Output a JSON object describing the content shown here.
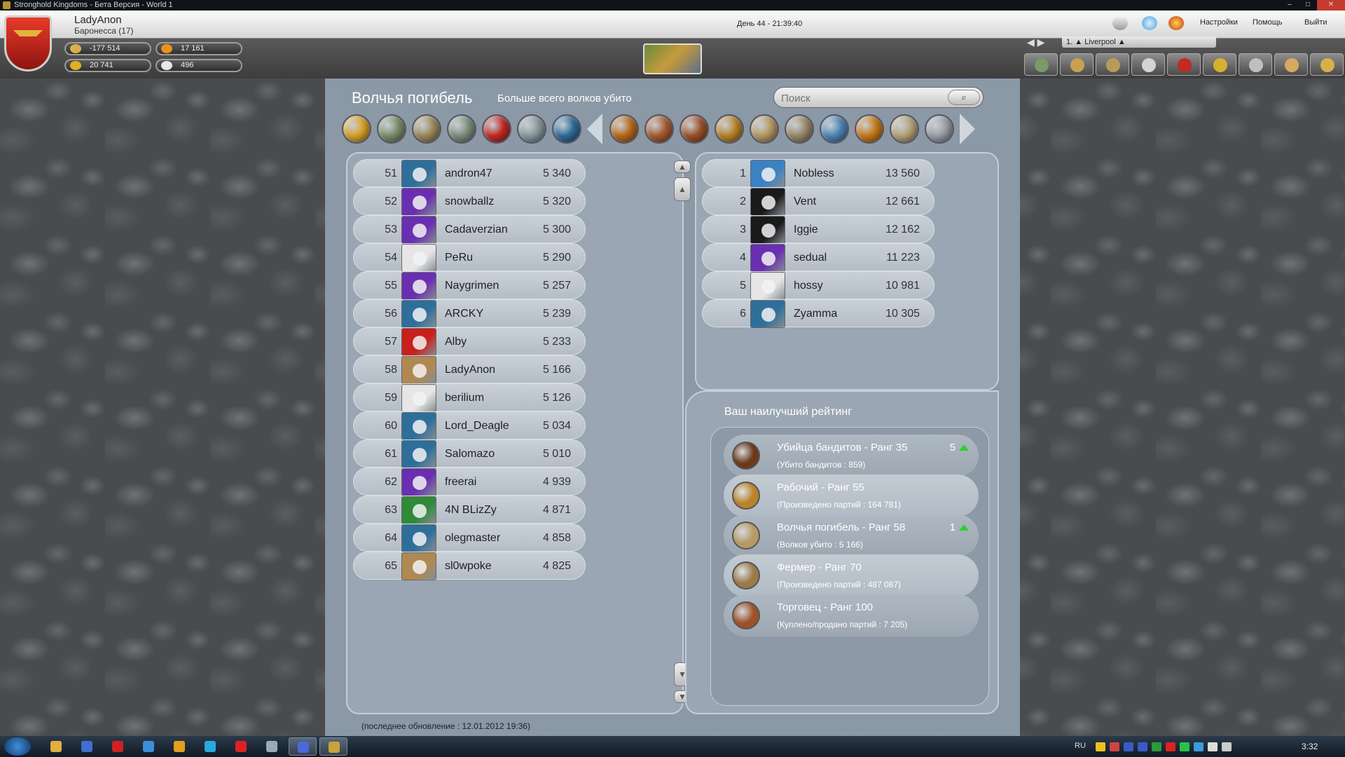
{
  "window": {
    "title": "Stronghold Kingdoms - Бета Версия - World 1",
    "controls": [
      "–",
      "□",
      "✕"
    ]
  },
  "header": {
    "player_name": "LadyAnon",
    "player_rank": "Баронесса (17)",
    "resources": [
      {
        "icon": "crown-icon",
        "value": "-177 514"
      },
      {
        "icon": "food-icon",
        "value": "17 161"
      },
      {
        "icon": "gold-coin-icon",
        "value": "20 741"
      },
      {
        "icon": "honor-icon",
        "value": "496"
      }
    ],
    "day_time": "День 44 - 21:39:40",
    "nav": {
      "settings": "Настройки",
      "help": "Помощь",
      "exit": "Выйти"
    },
    "village_arrows": "◀ ▶",
    "village": "1. ▲ Liverpool ▲"
  },
  "panel": {
    "title": "Волчья погибель",
    "subtitle": "Больше всего волков убито",
    "search": {
      "placeholder": "Поиск",
      "button": "⌕"
    },
    "categories": [
      {
        "name": "cat-orange",
        "color": "#d9a22a"
      },
      {
        "name": "cat-green",
        "color": "#7b8f6a"
      },
      {
        "name": "cat-camp",
        "color": "#9c8a5a"
      },
      {
        "name": "cat-tower",
        "color": "#7f8f7f"
      },
      {
        "name": "cat-red",
        "color": "#c12a24"
      },
      {
        "name": "cat-ship",
        "color": "#8a9a9e"
      },
      {
        "name": "cat-flag",
        "color": "#2f6c98"
      },
      {
        "name": "cat-castle",
        "color": "#b76a1c"
      },
      {
        "name": "cat-shield",
        "color": "#a85a2e"
      },
      {
        "name": "cat-bandit",
        "color": "#9c5228"
      },
      {
        "name": "cat-sword",
        "color": "#b8832a"
      },
      {
        "name": "cat-wolf",
        "color": "#b69a64"
      },
      {
        "name": "cat-farm",
        "color": "#9a8a6a"
      },
      {
        "name": "cat-globe",
        "color": "#4f86b4"
      },
      {
        "name": "cat-horse",
        "color": "#c77a18"
      },
      {
        "name": "cat-scroll",
        "color": "#b4a47a"
      },
      {
        "name": "cat-ruins",
        "color": "#9aa0a6"
      }
    ],
    "ranking": [
      {
        "rank": "51",
        "name": "andron47",
        "score": "5 340",
        "color": "#2e6f9a"
      },
      {
        "rank": "52",
        "name": "snowballz",
        "score": "5 320",
        "color": "#6a2fb0"
      },
      {
        "rank": "53",
        "name": "Cadaverzian",
        "score": "5 300",
        "color": "#6a2fb0"
      },
      {
        "rank": "54",
        "name": "PeRu",
        "score": "5 290",
        "color": "#e6e6e6"
      },
      {
        "rank": "55",
        "name": "Naygrimen",
        "score": "5 257",
        "color": "#6a2fb0"
      },
      {
        "rank": "56",
        "name": "ARCKY",
        "score": "5 239",
        "color": "#2e6f9a"
      },
      {
        "rank": "57",
        "name": "Alby",
        "score": "5 233",
        "color": "#c8201c"
      },
      {
        "rank": "58",
        "name": "LadyAnon",
        "score": "5 166",
        "color": "#b08852"
      },
      {
        "rank": "59",
        "name": "berilium",
        "score": "5 126",
        "color": "#e6e6e6"
      },
      {
        "rank": "60",
        "name": "Lord_Deagle",
        "score": "5 034",
        "color": "#2e6f9a"
      },
      {
        "rank": "61",
        "name": "Salomazo",
        "score": "5 010",
        "color": "#2e6f9a"
      },
      {
        "rank": "62",
        "name": "freerai",
        "score": "4 939",
        "color": "#6a2fb0"
      },
      {
        "rank": "63",
        "name": "4N BLizZy",
        "score": "4 871",
        "color": "#2f8a3a"
      },
      {
        "rank": "64",
        "name": "olegmaster",
        "score": "4 858",
        "color": "#2e6f9a"
      },
      {
        "rank": "65",
        "name": "sl0wpoke",
        "score": "4 825",
        "color": "#b08852"
      }
    ],
    "top": [
      {
        "rank": "1",
        "name": "Nobless",
        "score": "13 560",
        "color": "#3a82c4"
      },
      {
        "rank": "2",
        "name": "Vent",
        "score": "12 661",
        "color": "#1a1a1a"
      },
      {
        "rank": "3",
        "name": "Iggie",
        "score": "12 162",
        "color": "#1a1a1a"
      },
      {
        "rank": "4",
        "name": "sedual",
        "score": "11 223",
        "color": "#6a2fb0"
      },
      {
        "rank": "5",
        "name": "hossy",
        "score": "10 981",
        "color": "#e6e6e6"
      },
      {
        "rank": "6",
        "name": "Zyamma",
        "score": "10 305",
        "color": "#2e6f9a"
      }
    ],
    "best": {
      "title": "Ваш наилучший рейтинг",
      "items": [
        {
          "title": "Убийца бандитов - Ранг 35",
          "sub": "(Убито бандитов : 859)",
          "change": "5",
          "color": "#6a3a1a"
        },
        {
          "title": "Рабочий - Ранг 55",
          "sub": "(Произведено партий : 164 781)",
          "change": "",
          "color": "#b8832a"
        },
        {
          "title": "Волчья погибель - Ранг 58",
          "sub": "(Волков убито : 5 166)",
          "change": "1",
          "color": "#b69a64"
        },
        {
          "title": "Фермер - Ранг 70",
          "sub": "(Произведено партий : 487 087)",
          "change": "",
          "color": "#9a7a4a"
        },
        {
          "title": "Торговец - Ранг 100",
          "sub": "(Куплено/продано партий : 7 205)",
          "change": "",
          "color": "#9c5228"
        }
      ]
    },
    "updated": "(последнее обновление : 12.01.2012 19:36)"
  },
  "taskbar": {
    "apps": [
      {
        "n": "explorer",
        "c": "#e0b040"
      },
      {
        "n": "save",
        "c": "#3f6fcf"
      },
      {
        "n": "pdf",
        "c": "#c22"
      },
      {
        "n": "app4",
        "c": "#3a8fdc"
      },
      {
        "n": "chrome",
        "c": "#e0a020"
      },
      {
        "n": "skype",
        "c": "#2aa8e0"
      },
      {
        "n": "app7",
        "c": "#d22"
      },
      {
        "n": "notepad",
        "c": "#9ab"
      },
      {
        "n": "app9",
        "c": "#4a6adc"
      },
      {
        "n": "stronghold",
        "c": "#c9a23a"
      }
    ],
    "lang": "RU",
    "time": "3:32"
  }
}
